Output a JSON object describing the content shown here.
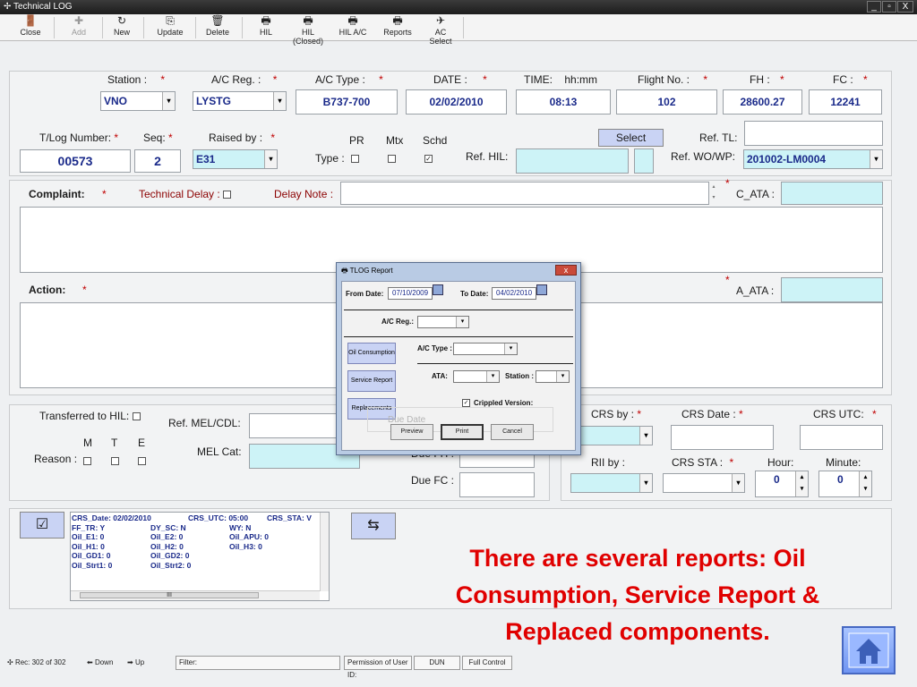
{
  "window": {
    "title": "Technical LOG",
    "controls": [
      "_",
      "▫",
      "X"
    ]
  },
  "toolbar": {
    "items": [
      {
        "label": "Close",
        "icon": "close-door-icon",
        "enabled": true
      },
      {
        "label": "Add",
        "icon": "add-icon",
        "enabled": false
      },
      {
        "label": "New",
        "icon": "new-icon",
        "enabled": true
      },
      {
        "label": "Update",
        "icon": "update-icon",
        "enabled": true
      },
      {
        "label": "Delete",
        "icon": "trash-icon",
        "enabled": true
      },
      {
        "label": "HIL",
        "icon": "printer-icon",
        "enabled": true
      },
      {
        "label": "HIL (Closed)",
        "icon": "printer-icon",
        "enabled": true
      },
      {
        "label": "HIL A/C",
        "icon": "printer-icon",
        "enabled": true
      },
      {
        "label": "Reports",
        "icon": "printer-icon",
        "enabled": true
      },
      {
        "label": "AC Select",
        "icon": "airplane-icon",
        "enabled": true
      }
    ]
  },
  "header": {
    "station_label": "Station :",
    "station_value": "VNO",
    "acreg_label": "A/C Reg. :",
    "acreg_value": "LYSTG",
    "actype_label": "A/C Type :",
    "actype_value": "B737-700",
    "date_label": "DATE :",
    "date_value": "02/02/2010",
    "time_label": "TIME:",
    "time_format": "hh:mm",
    "time_value": "08:13",
    "flight_label": "Flight No. :",
    "flight_value": "102",
    "fh_label": "FH :",
    "fh_value": "28600.27",
    "fc_label": "FC :",
    "fc_value": "12241",
    "star": "*"
  },
  "row2": {
    "tlog_label": "T/Log Number:",
    "tlog_value": "00573",
    "seq_label": "Seq:",
    "seq_value": "2",
    "raised_label": "Raised by :",
    "raised_value": "E31",
    "type_label": "Type :",
    "pr_label": "PR",
    "mtx_label": "Mtx",
    "schd_label": "Schd",
    "refhil_label": "Ref. HIL:",
    "select_label": "Select",
    "reftl_label": "Ref. TL:",
    "refwo_label": "Ref. WO/WP:",
    "refwo_value": "201002-LM0004"
  },
  "complaint": {
    "label": "Complaint:",
    "techdelay_label": "Technical Delay :",
    "delaynote_label": "Delay Note :",
    "cata_label": "C_ATA :"
  },
  "action": {
    "label": "Action:",
    "aata_label": "A_ATA :"
  },
  "lower": {
    "transferred_label": "Transferred to HIL:",
    "m_label": "M",
    "t_label": "T",
    "e_label": "E",
    "reason_label": "Reason :",
    "refmel_label": "Ref. MEL/CDL:",
    "melcat_label": "MEL Cat:",
    "dueff_label": "Due FH :",
    "duefc_label": "Due FC :",
    "duedate_label": "Due Date",
    "crsby_label": "CRS by :",
    "crsdate_label": "CRS Date :",
    "crsutc_label": "CRS UTC:",
    "riiby_label": "RII by :",
    "crssta_label": "CRS STA :",
    "hour_label": "Hour:",
    "hour_value": "0",
    "minute_label": "Minute:",
    "minute_value": "0"
  },
  "info": {
    "line1": [
      "CRS_Date:  02/02/2010",
      "CRS_UTC:  05:00",
      "CRS_STA:  V"
    ],
    "line2": [
      "FF_TR:  Y",
      "DY_SC:  N",
      "WY:  N"
    ],
    "line3": [
      "Oil_E1:  0",
      "Oil_E2:  0",
      "Oil_APU:  0"
    ],
    "line4": [
      "Oil_H1:  0",
      "Oil_H2:  0",
      "Oil_H3:  0"
    ],
    "line5": [
      "Oil_GD1:  0",
      "Oil_GD2:  0"
    ],
    "line6": [
      "Oil_Strt1:  0",
      "Oil_Strt2:  0"
    ],
    "scroll_mid": "III"
  },
  "dialog": {
    "title": "TLOG Report",
    "from_label": "From Date:",
    "from_value": "07/10/2009",
    "to_label": "To Date:",
    "to_value": "04/02/2010",
    "acreg_label": "A/C Reg.:",
    "actype_label": "A/C Type :",
    "ata_label": "ATA:",
    "station_label": "Station :",
    "crippled_label": "Crippled Version:",
    "side_buttons": [
      "Oil Consumption",
      "Service Report",
      "Replacements"
    ],
    "preview_label": "Preview",
    "print_label": "Print",
    "cancel_label": "Cancel"
  },
  "status": {
    "rec_label": "Rec: 302 of 302",
    "down_label": "Down",
    "up_label": "Up",
    "filter_label": "Filter:",
    "permission_label": "Permission of User ID:",
    "user_value": "DUN",
    "control_value": "Full Control"
  },
  "annotation": "There are several reports: Oil Consumption, Service Report & Replaced components.",
  "colors": {
    "accent_field": "#cdf3f7",
    "mandatory": "#c00000",
    "annotation": "#e00000",
    "value_text": "#1a2a8a"
  }
}
